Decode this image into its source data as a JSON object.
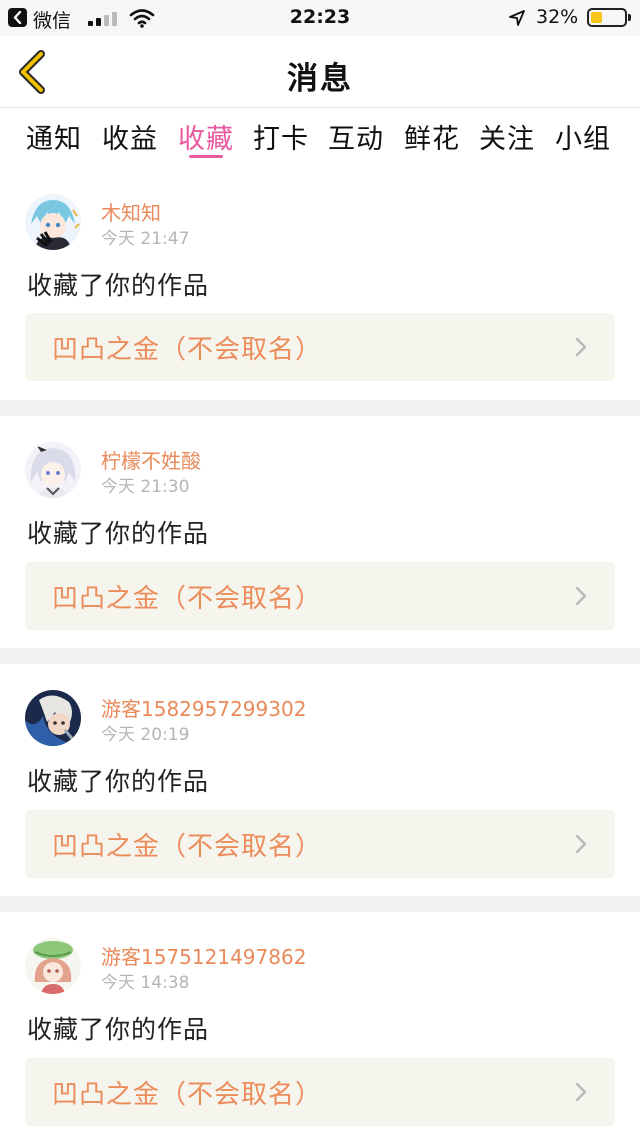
{
  "status_bar": {
    "app_name": "微信",
    "time": "22:23",
    "battery_percent": "32%",
    "battery_level": 0.32,
    "icons": [
      "back-to-app-icon",
      "signal-icon",
      "wifi-icon",
      "location-arrow-icon",
      "battery-icon"
    ]
  },
  "nav": {
    "title": "消息",
    "back_icon": "chevron-left-icon"
  },
  "tabs": [
    {
      "label": "通知",
      "active": false
    },
    {
      "label": "收益",
      "active": false
    },
    {
      "label": "收藏",
      "active": true
    },
    {
      "label": "打卡",
      "active": false
    },
    {
      "label": "互动",
      "active": false
    },
    {
      "label": "鲜花",
      "active": false
    },
    {
      "label": "关注",
      "active": false
    },
    {
      "label": "小组",
      "active": false
    }
  ],
  "messages": [
    {
      "user": "木知知",
      "time": "今天 21:47",
      "action": "收藏了你的作品",
      "work": "凹凸之金（不会取名）"
    },
    {
      "user": "柠檬不姓酸",
      "time": "今天 21:30",
      "action": "收藏了你的作品",
      "work": "凹凸之金（不会取名）"
    },
    {
      "user": "游客1582957299302",
      "time": "今天 20:19",
      "action": "收藏了你的作品",
      "work": "凹凸之金（不会取名）"
    },
    {
      "user": "游客1575121497862",
      "time": "今天 14:38",
      "action": "收藏了你的作品",
      "work": "凹凸之金（不会取名）"
    }
  ],
  "colors": {
    "accent_pink": "#e85a9f",
    "username_orange": "#e88a5a",
    "work_title_orange": "#ec8c5a",
    "back_chevron_yellow": "#f2c200"
  }
}
